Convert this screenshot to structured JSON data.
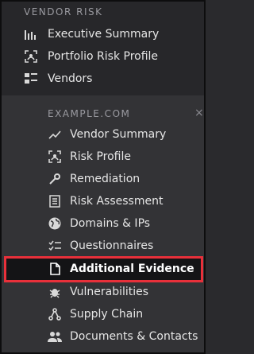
{
  "vendor_risk": {
    "title": "VENDOR RISK",
    "items": [
      {
        "label": "Executive Summary"
      },
      {
        "label": "Portfolio Risk Profile"
      },
      {
        "label": "Vendors"
      }
    ]
  },
  "vendor": {
    "title": "EXAMPLE.COM",
    "close_glyph": "×",
    "items": [
      {
        "label": "Vendor Summary"
      },
      {
        "label": "Risk Profile"
      },
      {
        "label": "Remediation"
      },
      {
        "label": "Risk Assessment"
      },
      {
        "label": "Domains & IPs"
      },
      {
        "label": "Questionnaires"
      },
      {
        "label": "Additional Evidence",
        "selected": true
      },
      {
        "label": "Vulnerabilities"
      },
      {
        "label": "Supply Chain"
      },
      {
        "label": "Documents & Contacts"
      }
    ]
  },
  "colors": {
    "highlight_border": "#e8303a",
    "panel_bg": "#333336",
    "top_bg": "#27272a"
  }
}
